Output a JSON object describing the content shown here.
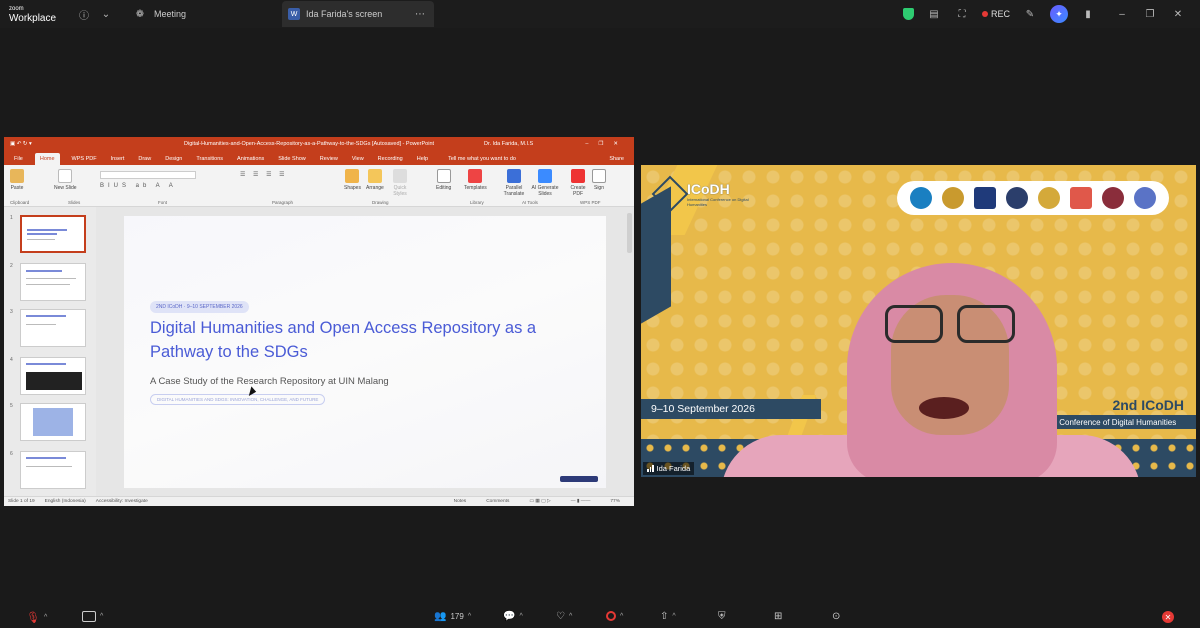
{
  "topbar": {
    "logo_line1": "zoom",
    "logo_line2": "Workplace",
    "meeting_label": "Meeting",
    "screen_tab_badge": "W",
    "screen_tab_label": "Ida Farida's screen",
    "rec_label": "REC"
  },
  "ppt": {
    "title": "Digital-Humanities-and-Open-Access-Repository-as-a-Pathway-to-the-SDGs [Autosaved] - PowerPoint",
    "user": "Dr. Ida Farida, M.I.S",
    "menu": [
      "File",
      "Home",
      "WPS PDF",
      "Insert",
      "Draw",
      "Design",
      "Transitions",
      "Animations",
      "Slide Show",
      "Review",
      "View",
      "Recording",
      "Help"
    ],
    "tell_me": "Tell me what you want to do",
    "share": "Share",
    "ribbon": {
      "paste": "Paste",
      "new_slide": "New Slide",
      "shapes": "Shapes",
      "arrange": "Arrange",
      "quick_styles": "Quick Styles",
      "editing": "Editing",
      "templates": "Templates",
      "parallel_translate": "Parallel Translate",
      "ai_generate": "AI Generate Slides",
      "create_pdf": "Create PDF",
      "sign": "Sign",
      "groups": [
        "Clipboard",
        "Slides",
        "Font",
        "Paragraph",
        "Drawing",
        "Library",
        "AI Tools",
        "WPS PDF"
      ]
    },
    "slide_numbers": [
      "1",
      "2",
      "3",
      "4",
      "5",
      "6"
    ],
    "slide": {
      "badge": "2ND ICoDH · 9–10 SEPTEMBER 2026",
      "title": "Digital Humanities and Open Access Repository as a Pathway to the SDGs",
      "subtitle": "A Case Study of the Research Repository at UIN Malang",
      "tag": "DIGITAL HUMANITIES AND SDGS: INNOVATION, CHALLENGE, AND FUTURE"
    },
    "status": {
      "slide_of": "Slide 1 of 19",
      "language": "English (Indonesia)",
      "accessibility": "Accessibility: Investigate",
      "notes": "Notes",
      "comments": "Comments",
      "zoom": "77%"
    }
  },
  "video": {
    "brand": "ICoDH",
    "brand_sub": "International Conference on Digital Humanities",
    "date": "9–10 September 2026",
    "conf_title": "2nd ICoDH",
    "conf_sub": "International Conference of Digital Humanities",
    "participant_name": "Ida Farida"
  },
  "bottombar": {
    "participants_count": "179"
  },
  "colors": {
    "ppt_red": "#c43e1c",
    "slide_blue": "#4a5bd6",
    "banner_yellow": "#e7b94a",
    "banner_navy": "#2d4a63"
  }
}
